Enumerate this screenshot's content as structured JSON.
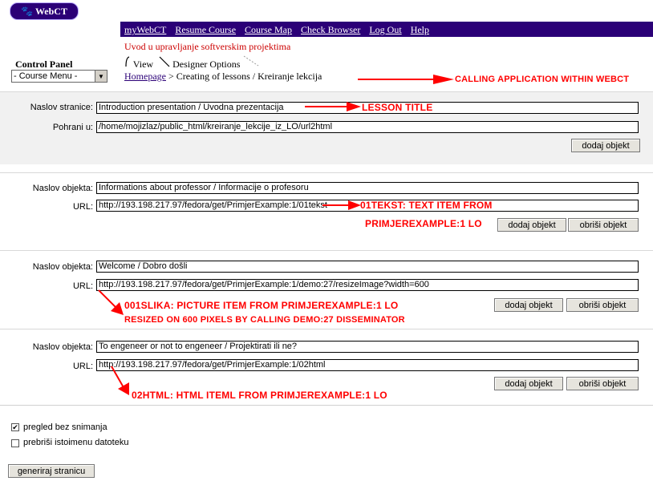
{
  "logo": {
    "text": "WebCT"
  },
  "nav": {
    "items": [
      "myWebCT",
      "Resume Course",
      "Course Map",
      "Check Browser",
      "Log Out",
      "Help"
    ]
  },
  "course": {
    "title": "Uvod u upravljanje softverskim projektima"
  },
  "control_panel": {
    "label": "Control Panel",
    "menu_value": "- Course Menu -"
  },
  "tabs": {
    "view": "View",
    "designer": "Designer Options"
  },
  "breadcrumb": {
    "home": "Homepage",
    "rest": "> Creating of lessons / Kreiranje lekcija"
  },
  "annotations": {
    "calling": "CALLING APPLICATION WITHIN WEBCT",
    "lesson_title": "LESSON TITLE",
    "tekst_line1": "01TEKST: TEXT ITEM FROM",
    "tekst_line2": "PRIMJEREXAMPLE:1 LO",
    "slika_line1": "001SLIKA: PICTURE ITEM FROM PRIMJEREXAMPLE:1 LO",
    "slika_line2": "RESIZED ON 600 PIXELS BY CALLING DEMO:27 DISSEMINATOR",
    "html_line1": "02HTML: HTML ITEML FROM PRIMJEREXAMPLE:1 LO"
  },
  "page_section": {
    "title_label": "Naslov stranice:",
    "title_value": "Introduction presentation / Uvodna prezentacija",
    "save_label": "Pohrani u:",
    "save_value": "/home/mojizlaz/public_html/kreiranje_lekcije_iz_LO/url2html",
    "add_button": "dodaj objekt"
  },
  "objects": [
    {
      "title_label": "Naslov objekta:",
      "title_value": "Informations about professor / Informacije o profesoru",
      "url_label": "URL:",
      "url_value": "http://193.198.217.97/fedora/get/PrimjerExample:1/01tekst",
      "add_button": "dodaj objekt",
      "delete_button": "obriši objekt"
    },
    {
      "title_label": "Naslov objekta:",
      "title_value": "Welcome / Dobro došli",
      "url_label": "URL:",
      "url_value": "http://193.198.217.97/fedora/get/PrimjerExample:1/demo:27/resizeImage?width=600",
      "add_button": "dodaj objekt",
      "delete_button": "obriši objekt"
    },
    {
      "title_label": "Naslov objekta:",
      "title_value": "To engeneer or not to engeneer / Projektirati ili ne?",
      "url_label": "URL:",
      "url_value": "http://193.198.217.97/fedora/get/PrimjerExample:1/02html",
      "add_button": "dodaj objekt",
      "delete_button": "obriši objekt"
    }
  ],
  "options": {
    "preview_label": "pregled bez snimanja",
    "preview_checked": true,
    "overwrite_label": "prebriši istoimenu datoteku",
    "overwrite_checked": false
  },
  "generate_button": "generiraj stranicu",
  "colors": {
    "nav_bar": "#2b0077",
    "annotation": "#ff0000",
    "course_title": "#cc0000"
  }
}
